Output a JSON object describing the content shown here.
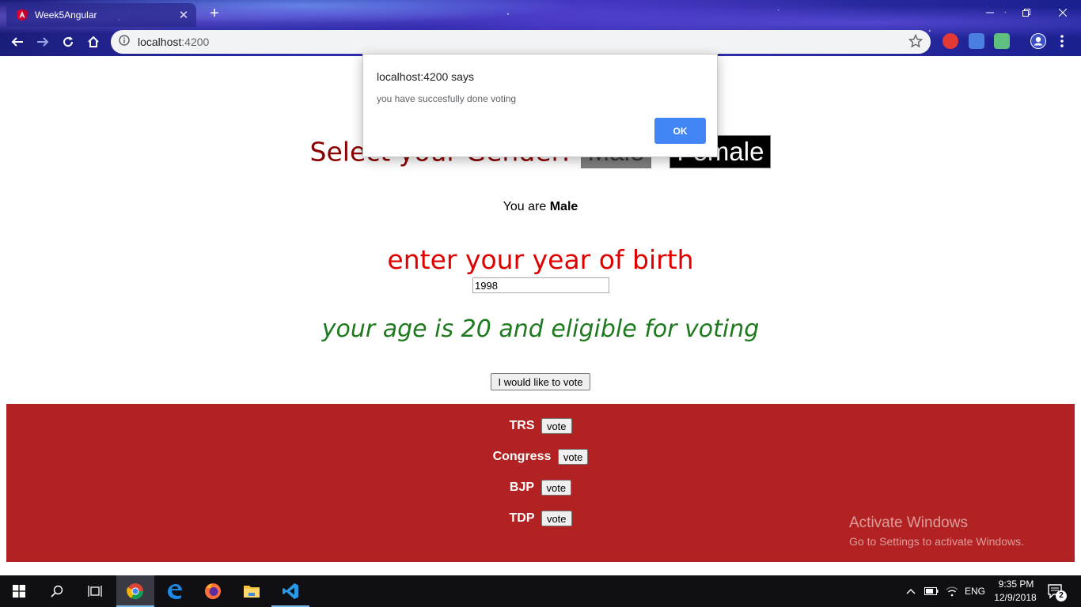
{
  "browser": {
    "tab_title": "Week5Angular",
    "tab_close": "✕",
    "new_tab": "+",
    "url_host": "localhost",
    "url_port": ":4200"
  },
  "page": {
    "gender_label": "Select your Gender:",
    "male_button": "Male",
    "female_button": "Female",
    "you_are_prefix": "You are",
    "you_are_value": "Male",
    "dob_label": "enter your year of birth",
    "dob_value": "1998",
    "age_message": "your age is 20 and eligible for voting",
    "vote_intent_button": "I would like to vote",
    "parties": [
      {
        "name": "TRS",
        "button": "vote"
      },
      {
        "name": "Congress",
        "button": "vote"
      },
      {
        "name": "BJP",
        "button": "vote"
      },
      {
        "name": "TDP",
        "button": "vote"
      }
    ]
  },
  "dialog": {
    "title": "localhost:4200 says",
    "message": "you have succesfully done voting",
    "ok_label": "OK"
  },
  "watermark": {
    "line1": "Activate Windows",
    "line2": "Go to Settings to activate Windows."
  },
  "taskbar": {
    "language": "ENG",
    "time": "9:35 PM",
    "date": "12/9/2018",
    "notifications": "2"
  }
}
